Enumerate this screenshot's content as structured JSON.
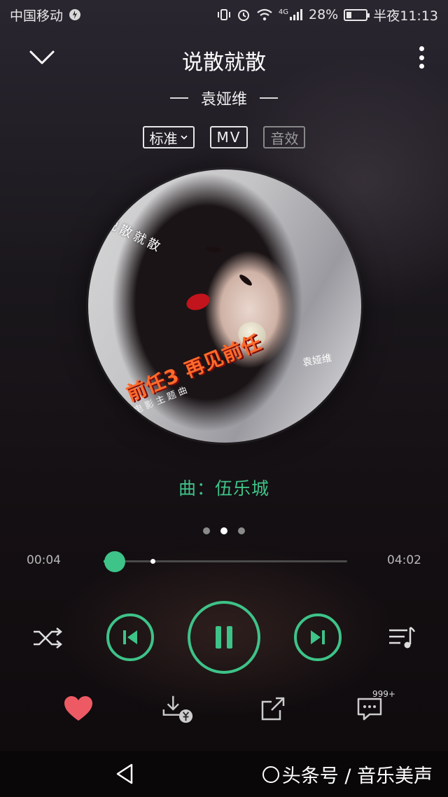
{
  "status_bar": {
    "carrier": "中国移动",
    "network": "4G",
    "battery": "28%",
    "battery_level": 0.28,
    "time": "半夜11:13"
  },
  "player": {
    "song_title": "说散就散",
    "artist": "袁娅维",
    "quality_label": "标准",
    "mv_label": "MV",
    "effect_label": "音效",
    "composer_line": "曲：伍乐城",
    "current_time": "00:04",
    "total_time": "04:02",
    "progress": 0.017,
    "buffered": 0.2,
    "page_count": 3,
    "active_page": 2,
    "comment_badge": "999+",
    "accent_color": "#3ec388"
  },
  "album_cover": {
    "cover_title": "说散就散",
    "poster_title": "前任3 再见前任",
    "poster_subtitle": "电影主题曲",
    "signature": "袁娅维"
  },
  "navigation": {
    "watermark": "头条号 / 音乐美声"
  }
}
